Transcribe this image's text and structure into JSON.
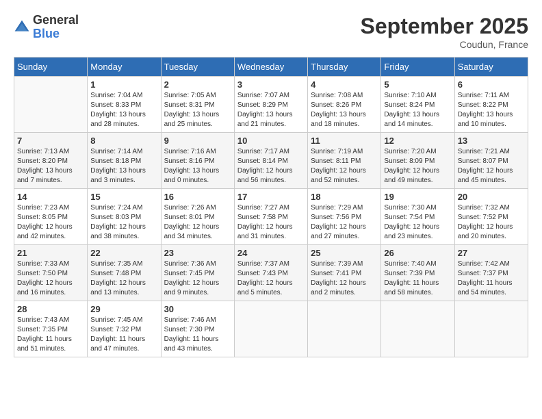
{
  "logo": {
    "general": "General",
    "blue": "Blue"
  },
  "title": {
    "month_year": "September 2025",
    "location": "Coudun, France"
  },
  "headers": [
    "Sunday",
    "Monday",
    "Tuesday",
    "Wednesday",
    "Thursday",
    "Friday",
    "Saturday"
  ],
  "weeks": [
    [
      {
        "day": "",
        "info": ""
      },
      {
        "day": "1",
        "info": "Sunrise: 7:04 AM\nSunset: 8:33 PM\nDaylight: 13 hours\nand 28 minutes."
      },
      {
        "day": "2",
        "info": "Sunrise: 7:05 AM\nSunset: 8:31 PM\nDaylight: 13 hours\nand 25 minutes."
      },
      {
        "day": "3",
        "info": "Sunrise: 7:07 AM\nSunset: 8:29 PM\nDaylight: 13 hours\nand 21 minutes."
      },
      {
        "day": "4",
        "info": "Sunrise: 7:08 AM\nSunset: 8:26 PM\nDaylight: 13 hours\nand 18 minutes."
      },
      {
        "day": "5",
        "info": "Sunrise: 7:10 AM\nSunset: 8:24 PM\nDaylight: 13 hours\nand 14 minutes."
      },
      {
        "day": "6",
        "info": "Sunrise: 7:11 AM\nSunset: 8:22 PM\nDaylight: 13 hours\nand 10 minutes."
      }
    ],
    [
      {
        "day": "7",
        "info": "Sunrise: 7:13 AM\nSunset: 8:20 PM\nDaylight: 13 hours\nand 7 minutes."
      },
      {
        "day": "8",
        "info": "Sunrise: 7:14 AM\nSunset: 8:18 PM\nDaylight: 13 hours\nand 3 minutes."
      },
      {
        "day": "9",
        "info": "Sunrise: 7:16 AM\nSunset: 8:16 PM\nDaylight: 13 hours\nand 0 minutes."
      },
      {
        "day": "10",
        "info": "Sunrise: 7:17 AM\nSunset: 8:14 PM\nDaylight: 12 hours\nand 56 minutes."
      },
      {
        "day": "11",
        "info": "Sunrise: 7:19 AM\nSunset: 8:11 PM\nDaylight: 12 hours\nand 52 minutes."
      },
      {
        "day": "12",
        "info": "Sunrise: 7:20 AM\nSunset: 8:09 PM\nDaylight: 12 hours\nand 49 minutes."
      },
      {
        "day": "13",
        "info": "Sunrise: 7:21 AM\nSunset: 8:07 PM\nDaylight: 12 hours\nand 45 minutes."
      }
    ],
    [
      {
        "day": "14",
        "info": "Sunrise: 7:23 AM\nSunset: 8:05 PM\nDaylight: 12 hours\nand 42 minutes."
      },
      {
        "day": "15",
        "info": "Sunrise: 7:24 AM\nSunset: 8:03 PM\nDaylight: 12 hours\nand 38 minutes."
      },
      {
        "day": "16",
        "info": "Sunrise: 7:26 AM\nSunset: 8:01 PM\nDaylight: 12 hours\nand 34 minutes."
      },
      {
        "day": "17",
        "info": "Sunrise: 7:27 AM\nSunset: 7:58 PM\nDaylight: 12 hours\nand 31 minutes."
      },
      {
        "day": "18",
        "info": "Sunrise: 7:29 AM\nSunset: 7:56 PM\nDaylight: 12 hours\nand 27 minutes."
      },
      {
        "day": "19",
        "info": "Sunrise: 7:30 AM\nSunset: 7:54 PM\nDaylight: 12 hours\nand 23 minutes."
      },
      {
        "day": "20",
        "info": "Sunrise: 7:32 AM\nSunset: 7:52 PM\nDaylight: 12 hours\nand 20 minutes."
      }
    ],
    [
      {
        "day": "21",
        "info": "Sunrise: 7:33 AM\nSunset: 7:50 PM\nDaylight: 12 hours\nand 16 minutes."
      },
      {
        "day": "22",
        "info": "Sunrise: 7:35 AM\nSunset: 7:48 PM\nDaylight: 12 hours\nand 13 minutes."
      },
      {
        "day": "23",
        "info": "Sunrise: 7:36 AM\nSunset: 7:45 PM\nDaylight: 12 hours\nand 9 minutes."
      },
      {
        "day": "24",
        "info": "Sunrise: 7:37 AM\nSunset: 7:43 PM\nDaylight: 12 hours\nand 5 minutes."
      },
      {
        "day": "25",
        "info": "Sunrise: 7:39 AM\nSunset: 7:41 PM\nDaylight: 12 hours\nand 2 minutes."
      },
      {
        "day": "26",
        "info": "Sunrise: 7:40 AM\nSunset: 7:39 PM\nDaylight: 11 hours\nand 58 minutes."
      },
      {
        "day": "27",
        "info": "Sunrise: 7:42 AM\nSunset: 7:37 PM\nDaylight: 11 hours\nand 54 minutes."
      }
    ],
    [
      {
        "day": "28",
        "info": "Sunrise: 7:43 AM\nSunset: 7:35 PM\nDaylight: 11 hours\nand 51 minutes."
      },
      {
        "day": "29",
        "info": "Sunrise: 7:45 AM\nSunset: 7:32 PM\nDaylight: 11 hours\nand 47 minutes."
      },
      {
        "day": "30",
        "info": "Sunrise: 7:46 AM\nSunset: 7:30 PM\nDaylight: 11 hours\nand 43 minutes."
      },
      {
        "day": "",
        "info": ""
      },
      {
        "day": "",
        "info": ""
      },
      {
        "day": "",
        "info": ""
      },
      {
        "day": "",
        "info": ""
      }
    ]
  ]
}
